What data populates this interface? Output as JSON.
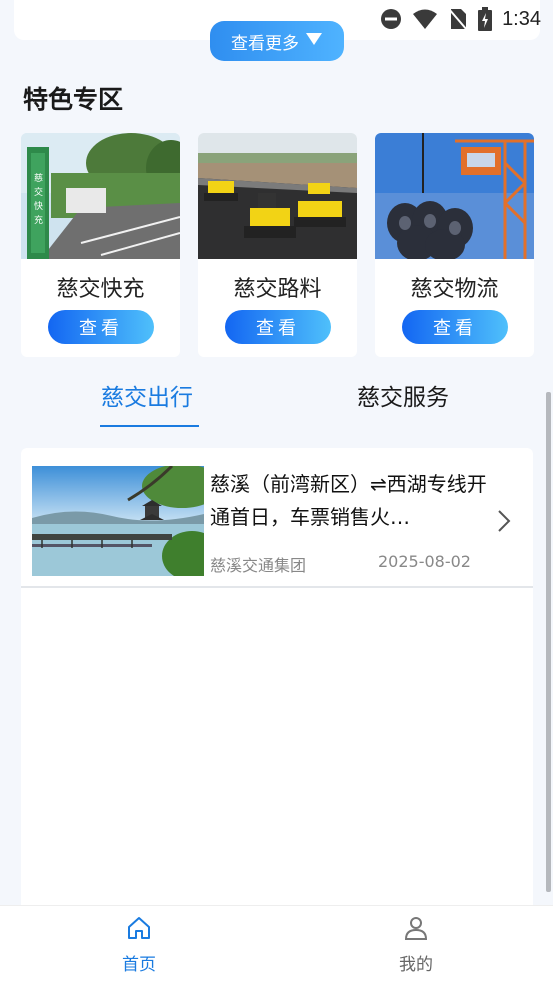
{
  "status_bar": {
    "time": "1:34",
    "icons": [
      "do-not-disturb-icon",
      "wifi-icon",
      "no-sim-icon",
      "battery-charging-icon"
    ]
  },
  "more_button": {
    "label": "查看更多",
    "icon": "triangle-down-icon"
  },
  "featured": {
    "title": "特色专区",
    "items": [
      {
        "name": "慈交快充",
        "button": "查看",
        "image": "ev-charging-parking-photo"
      },
      {
        "name": "慈交路料",
        "button": "查看",
        "image": "road-rollers-paving-photo"
      },
      {
        "name": "慈交物流",
        "button": "查看",
        "image": "steel-coils-crane-photo"
      }
    ]
  },
  "tabs": [
    {
      "label": "慈交出行",
      "active": true
    },
    {
      "label": "慈交服务",
      "active": false
    }
  ],
  "news": [
    {
      "title": "慈溪（前湾新区）⇌西湖专线开通首日，车票销售火…",
      "source": "慈溪交通集团",
      "date": "2025-08-02",
      "image": "west-lake-pavilion-photo"
    }
  ],
  "bottom_nav": [
    {
      "label": "首页",
      "icon": "home-icon",
      "active": true
    },
    {
      "label": "我的",
      "icon": "user-icon",
      "active": false
    }
  ],
  "colors": {
    "accent": "#1a7be0",
    "button_gradient_start": "#1366f2",
    "button_gradient_end": "#4fc0fb",
    "page_background": "#f4f7fc"
  }
}
